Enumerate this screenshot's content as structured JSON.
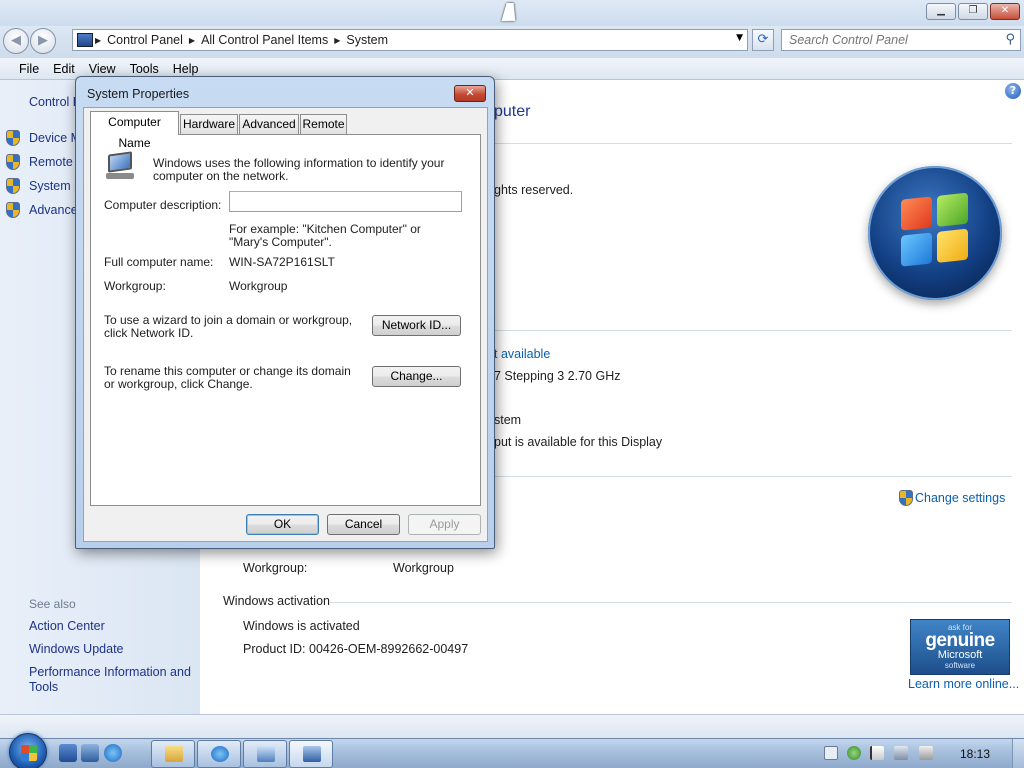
{
  "window": {
    "breadcrumb": [
      "Control Panel",
      "All Control Panel Items",
      "System"
    ],
    "search_placeholder": "Search Control Panel",
    "menu": [
      "File",
      "Edit",
      "View",
      "Tools",
      "Help"
    ]
  },
  "navpane": {
    "home": "Control P",
    "links": [
      "Device M",
      "Remote s",
      "System p",
      "Advance"
    ],
    "see_also_title": "See also",
    "see_also": [
      "Action Center",
      "Windows Update",
      "Performance Information and Tools"
    ]
  },
  "main": {
    "heading": "puter",
    "rights": "ghts reserved.",
    "rating_link": "t available",
    "processor": "7 Stepping 3   2.70 GHz",
    "system_type": "stem",
    "pen_touch": "put is available for this Display",
    "change_settings": "Change settings",
    "workgroup_label": "Workgroup:",
    "workgroup_value": "Workgroup",
    "activation_heading": "Windows activation",
    "activation_status": "Windows is activated",
    "product_id": "Product ID: 00426-OEM-8992662-00497",
    "genuine": {
      "ask": "ask for",
      "genuine": "genuine",
      "microsoft": "Microsoft",
      "software": "software"
    },
    "learn_more": "Learn more online..."
  },
  "dialog": {
    "title": "System Properties",
    "close_glyph": "✕",
    "tabs": [
      "Computer Name",
      "Hardware",
      "Advanced",
      "Remote"
    ],
    "intro": "Windows uses the following information to identify your computer on the network.",
    "description_label": "Computer description:",
    "description_value": "",
    "example": "For example: \"Kitchen Computer\" or \"Mary's Computer\".",
    "full_name_label": "Full computer name:",
    "full_name_value": "WIN-SA72P161SLT",
    "workgroup_label": "Workgroup:",
    "workgroup_value": "Workgroup",
    "wizard_text": "To use a wizard to join a domain or workgroup, click Network ID.",
    "network_id_button": "Network ID...",
    "rename_text": "To rename this computer or change its domain or workgroup, click Change.",
    "change_button": "Change...",
    "ok_button": "OK",
    "cancel_button": "Cancel",
    "apply_button": "Apply"
  },
  "taskbar": {
    "clock": "18:13"
  }
}
